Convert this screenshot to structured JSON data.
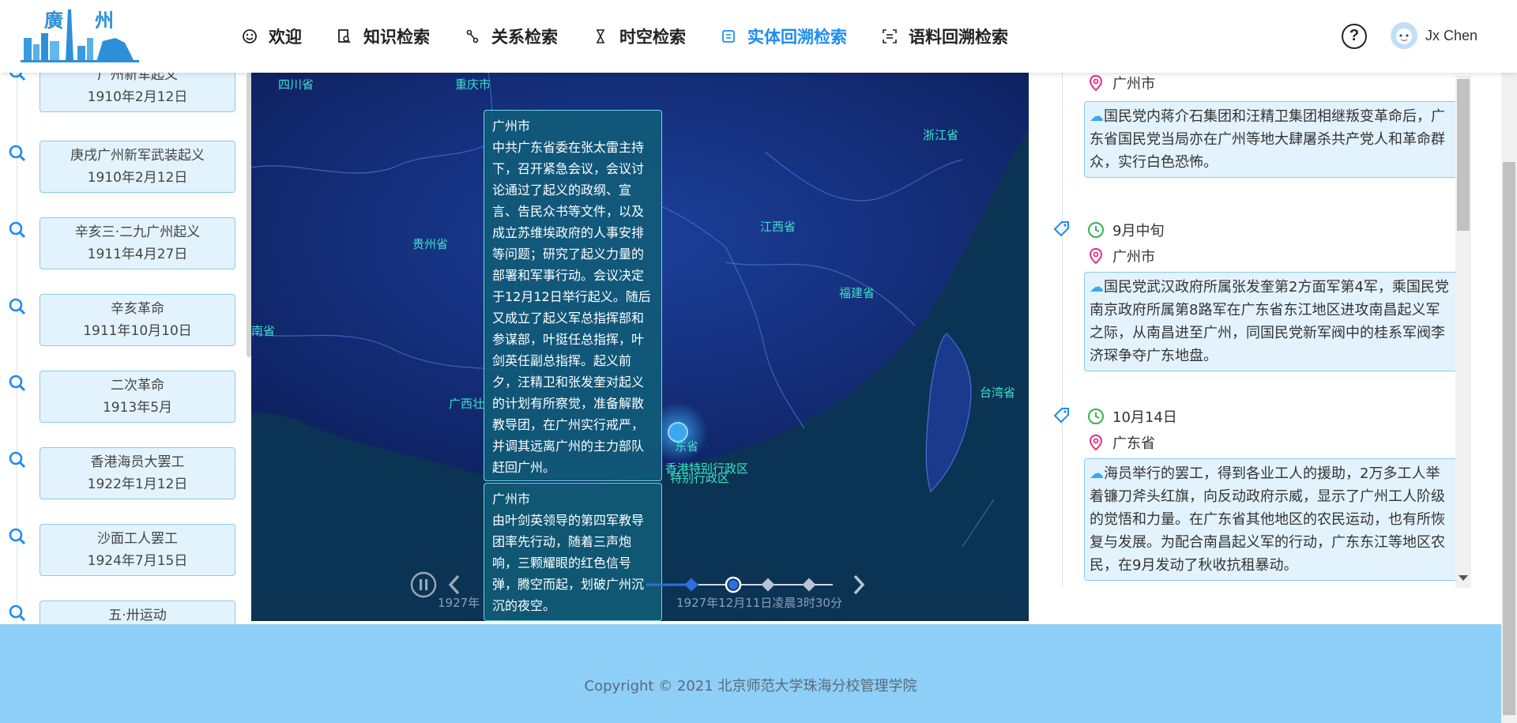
{
  "header": {
    "logo_text": "廣 州",
    "nav": [
      {
        "label": "欢迎",
        "icon": "smile-icon",
        "active": false
      },
      {
        "label": "知识检索",
        "icon": "document-search-icon",
        "active": false
      },
      {
        "label": "关系检索",
        "icon": "relation-icon",
        "active": false
      },
      {
        "label": "时空检索",
        "icon": "hourglass-icon",
        "active": false
      },
      {
        "label": "实体回溯检索",
        "icon": "entity-trace-icon",
        "active": true
      },
      {
        "label": "语料回溯检索",
        "icon": "corpus-scan-icon",
        "active": false
      }
    ],
    "help_symbol": "?",
    "user_name": "Jx Chen",
    "accent_color": "#1e8cf0"
  },
  "left_events": [
    {
      "name": "广州新军起义",
      "date": "1910年2月12日"
    },
    {
      "name": "庚戌广州新军武装起义",
      "date": "1910年2月12日"
    },
    {
      "name": "辛亥三·二九广州起义",
      "date": "1911年4月27日"
    },
    {
      "name": "辛亥革命",
      "date": "1911年10月10日"
    },
    {
      "name": "二次革命",
      "date": "1913年5月"
    },
    {
      "name": "香港海员大罢工",
      "date": "1922年1月12日"
    },
    {
      "name": "沙面工人罢工",
      "date": "1924年7月15日"
    },
    {
      "name": "五·卅运动",
      "date": ""
    }
  ],
  "map": {
    "provinces": [
      "四川省",
      "重庆市",
      "浙江省",
      "江西省",
      "贵州省",
      "福建省",
      "南省",
      "广西壮",
      "台湾省",
      "香港特别行政区",
      "特别行政区",
      "东省"
    ],
    "popups": [
      {
        "place": "广州市",
        "text": "中共广东省委在张太雷主持下，召开紧急会议，会议讨论通过了起义的政纲、宣言、告民众书等文件，以及成立苏维埃政府的人事安排等问题；研究了起义力量的部署和军事行动。会议决定于12月12日举行起义。随后又成立了起义军总指挥部和参谋部，叶挺任总指挥，叶剑英任副总指挥。起义前夕，汪精卫和张发奎对起义的计划有所察觉，准备解散教导团，在广州实行戒严，并调其远离广州的主力部队赶回广州。"
      },
      {
        "place": "广州市",
        "text": "由叶剑英领导的第四军教导团率先行动，随着三声炮响，三颗耀眼的红色信号弹，腾空而起，划破广州沉沉的夜空。"
      }
    ],
    "timeline": {
      "left_label": "1927年",
      "right_label": "1927年12月11日凌晨3时30分",
      "state": "playing"
    },
    "colors": {
      "marker": "#3aa8ee",
      "label": "#3de0c8"
    }
  },
  "right_entries": [
    {
      "time": "",
      "place": "广州市",
      "desc": "国民党内蒋介石集团和汪精卫集团相继叛变革命后，广东省国民党当局亦在广州等地大肆屠杀共产党人和革命群众，实行白色恐怖。"
    },
    {
      "time": "9月中旬",
      "place": "广州市",
      "desc": "国民党武汉政府所属张发奎第2方面军第4军，乘国民党南京政府所属第8路军在广东省东江地区进攻南昌起义军之际，从南昌进至广州，同国民党新军阀中的桂系军阀李济琛争夺广东地盘。"
    },
    {
      "time": "10月14日",
      "place": "广东省",
      "desc": "海员举行的罢工，得到各业工人的援助，2万多工人举着镰刀斧头红旗，向反动政府示威，显示了广州工人阶级的觉悟和力量。在广东省其他地区的农民运动，也有所恢复与发展。为配合南昌起义军的行动，广东东江等地区农民，在9月发动了秋收抗租暴动。"
    }
  ],
  "footer": {
    "copyright": "Copyright © 2021 北京师范大学珠海分校管理学院"
  }
}
